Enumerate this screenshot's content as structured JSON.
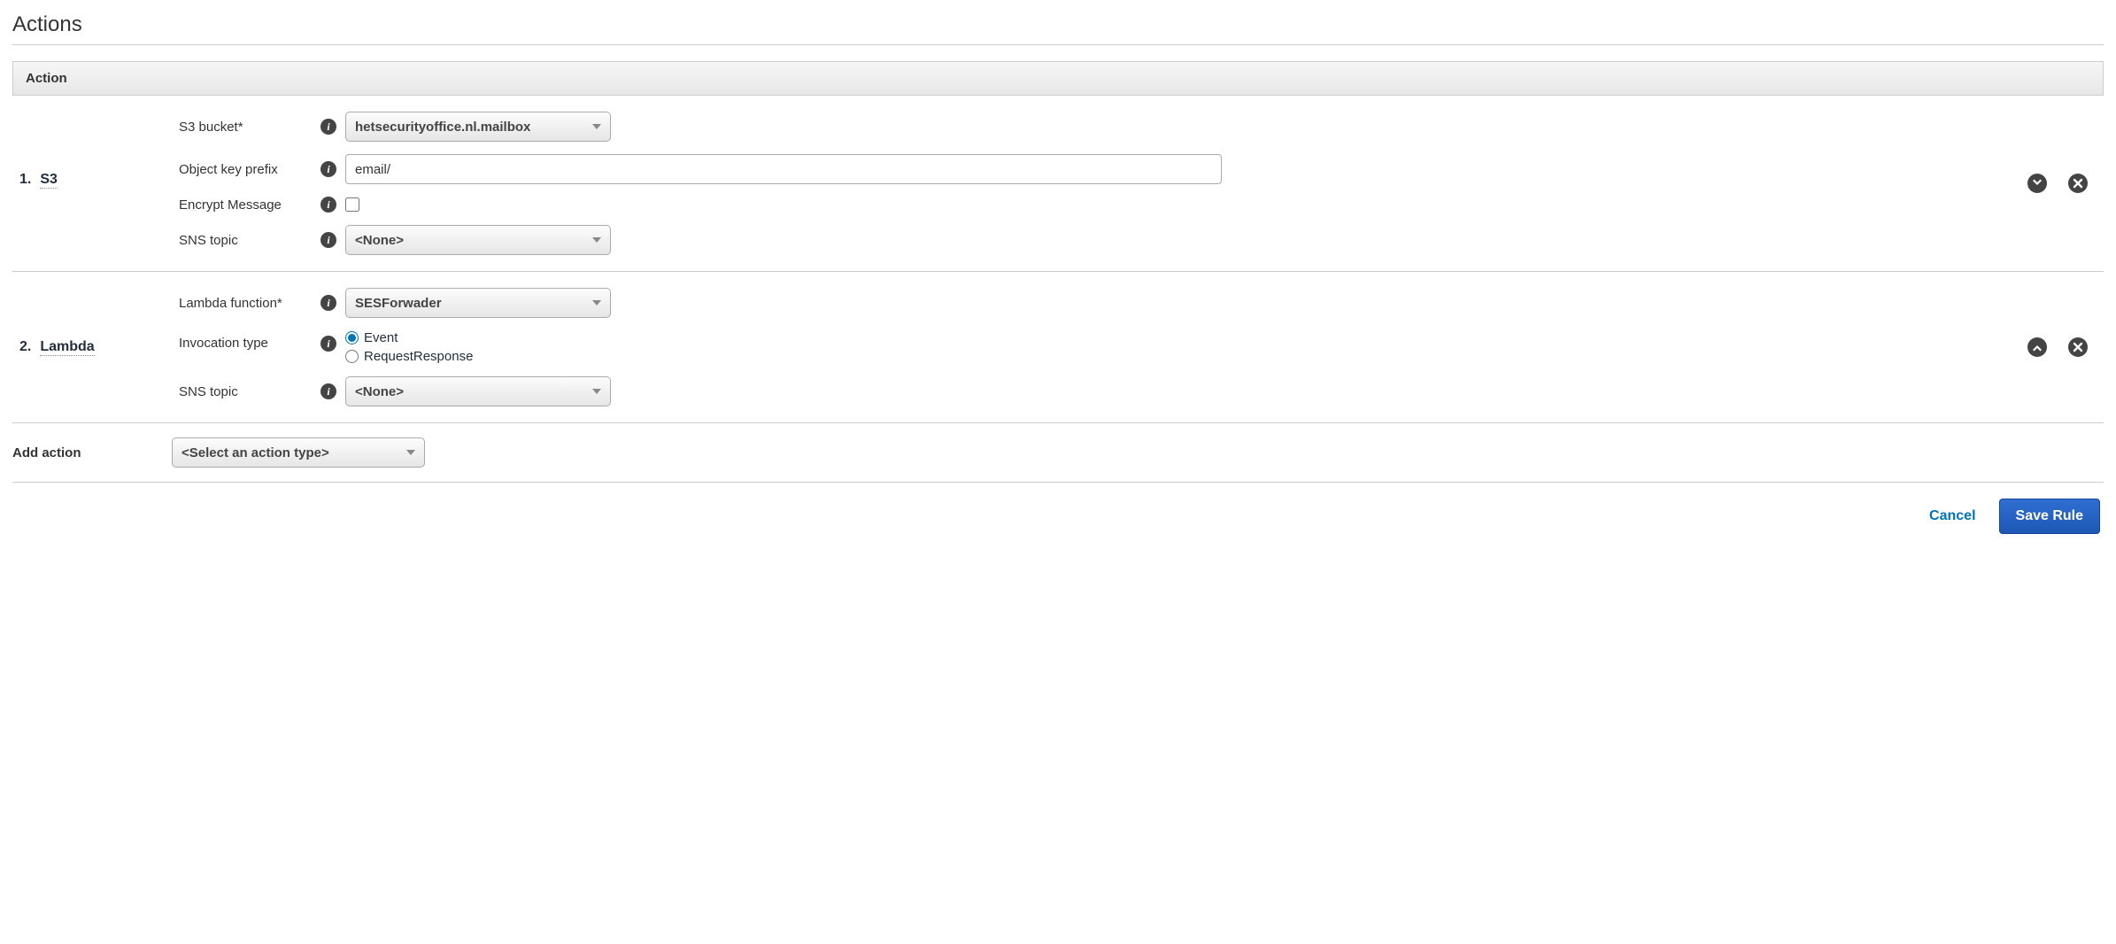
{
  "section_title": "Actions",
  "table_header": "Action",
  "actions": [
    {
      "index": "1.",
      "name": "S3",
      "fields": {
        "s3_bucket_label": "S3 bucket*",
        "s3_bucket_value": "hetsecurityoffice.nl.mailbox",
        "prefix_label": "Object key prefix",
        "prefix_value": "email/",
        "encrypt_label": "Encrypt Message",
        "sns_label": "SNS topic",
        "sns_value": "<None>"
      },
      "move_dir": "down"
    },
    {
      "index": "2.",
      "name": "Lambda",
      "fields": {
        "fn_label": "Lambda function*",
        "fn_value": "SESForwader",
        "invocation_label": "Invocation type",
        "invocation_opt1": "Event",
        "invocation_opt2": "RequestResponse",
        "sns_label": "SNS topic",
        "sns_value": "<None>"
      },
      "move_dir": "up"
    }
  ],
  "add_action": {
    "label": "Add action",
    "placeholder": "<Select an action type>"
  },
  "footer": {
    "cancel": "Cancel",
    "save": "Save Rule"
  }
}
